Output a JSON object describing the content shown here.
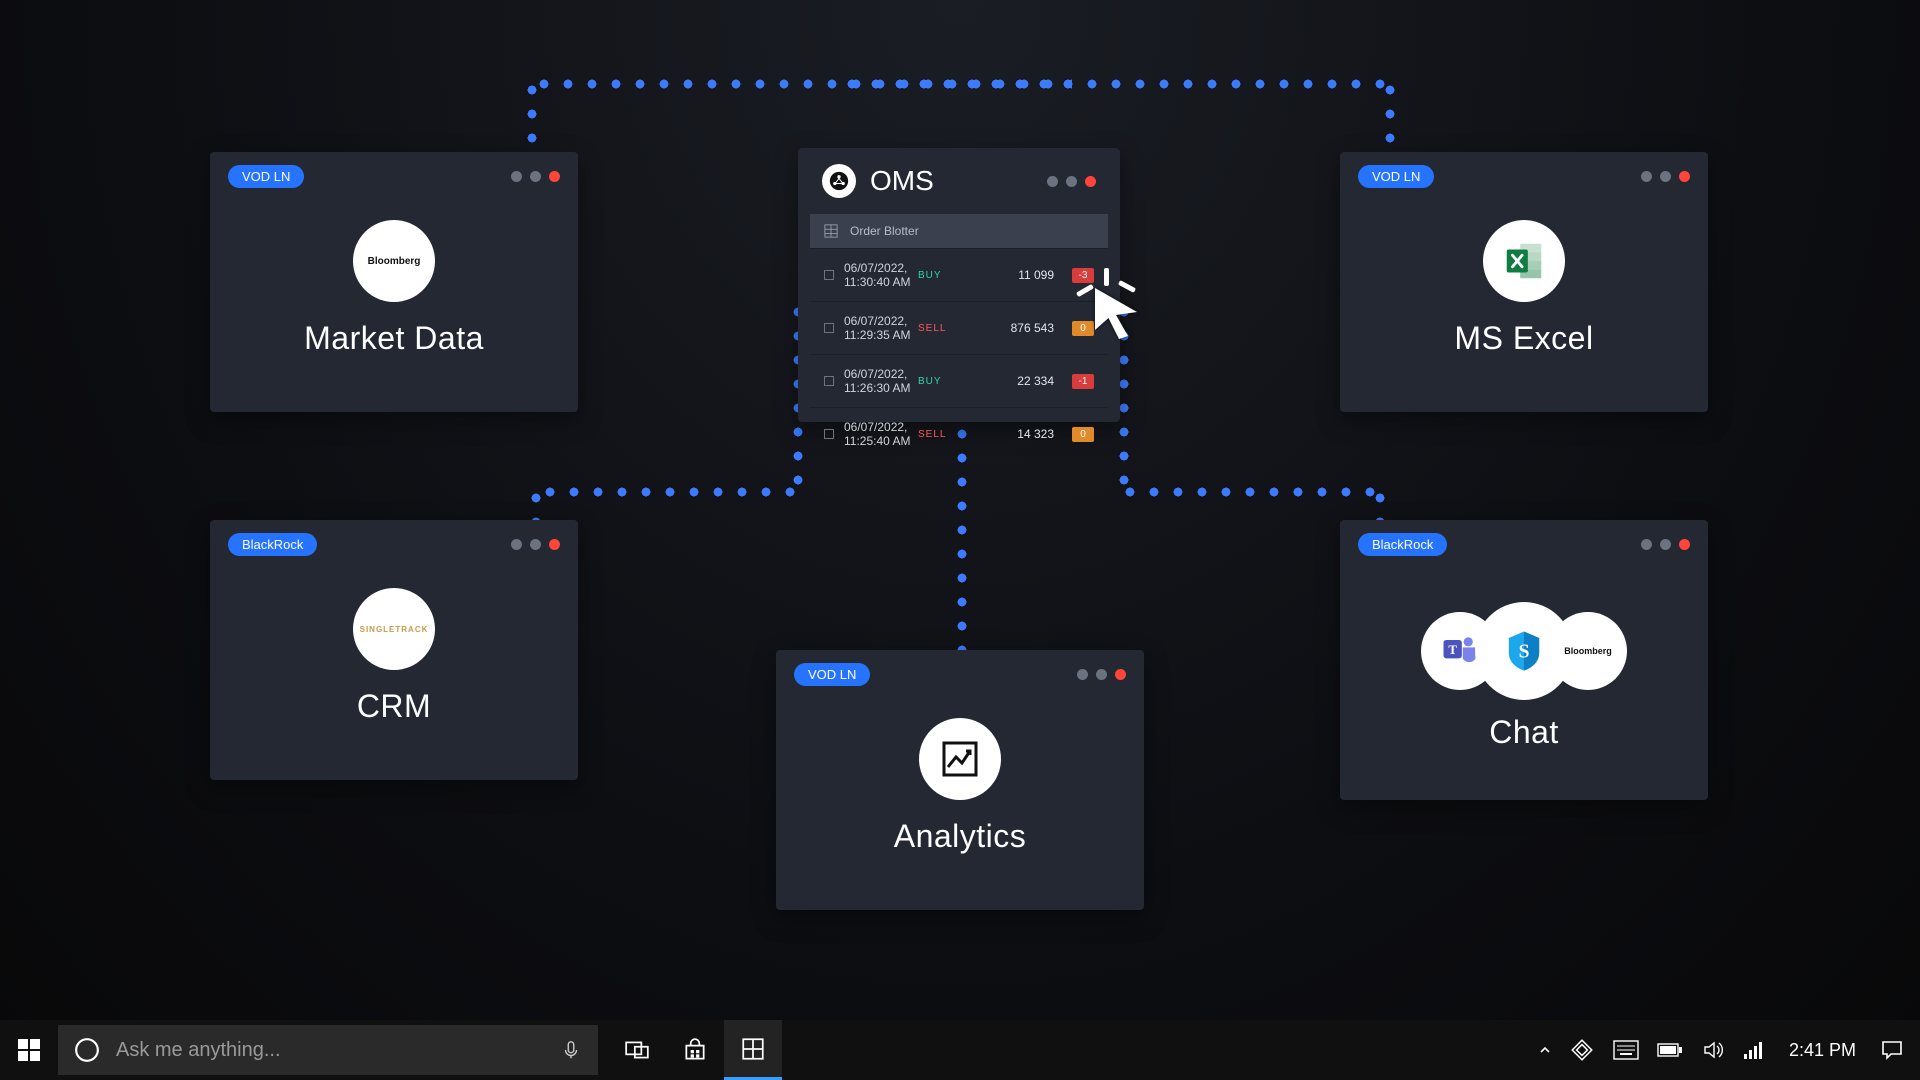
{
  "taskbar": {
    "search_placeholder": "Ask me anything...",
    "clock": "2:41 PM"
  },
  "panels": {
    "market_data": {
      "badge": "VOD LN",
      "title": "Market Data",
      "icon_text": "Bloomberg"
    },
    "excel": {
      "badge": "VOD LN",
      "title": "MS Excel"
    },
    "crm": {
      "badge": "BlackRock",
      "title": "CRM",
      "icon_text": "SINGLETRACK"
    },
    "chat": {
      "badge": "BlackRock",
      "title": "Chat",
      "icon_text_right": "Bloomberg"
    },
    "analytics": {
      "badge": "VOD LN",
      "title": "Analytics"
    }
  },
  "oms": {
    "title": "OMS",
    "blotter_header": "Order Blotter",
    "rows": [
      {
        "time": "06/07/2022, 11:30:40 AM",
        "side": "BUY",
        "qty": "11 099",
        "badge": "-3",
        "badge_class": "qb-red"
      },
      {
        "time": "06/07/2022, 11:29:35 AM",
        "side": "SELL",
        "qty": "876 543",
        "badge": "0",
        "badge_class": "qb-orange"
      },
      {
        "time": "06/07/2022, 11:26:30 AM",
        "side": "BUY",
        "qty": "22 334",
        "badge": "-1",
        "badge_class": "qb-red"
      },
      {
        "time": "06/07/2022, 11:25:40 AM",
        "side": "SELL",
        "qty": "14 323",
        "badge": "0",
        "badge_class": "qb-orange"
      }
    ]
  }
}
